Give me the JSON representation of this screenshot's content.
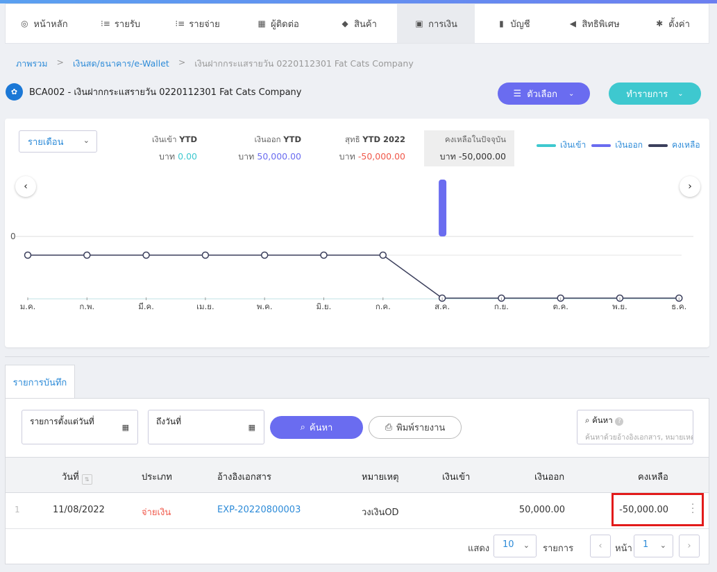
{
  "nav": {
    "items": [
      {
        "label": "หน้าหลัก",
        "icon": "dashboard-icon"
      },
      {
        "label": "รายรับ",
        "icon": "income-icon"
      },
      {
        "label": "รายจ่าย",
        "icon": "expense-icon"
      },
      {
        "label": "ผู้ติดต่อ",
        "icon": "contacts-icon"
      },
      {
        "label": "สินค้า",
        "icon": "product-box-icon"
      },
      {
        "label": "การเงิน",
        "icon": "money-icon"
      },
      {
        "label": "บัญชี",
        "icon": "ledger-icon"
      },
      {
        "label": "สิทธิพิเศษ",
        "icon": "megaphone-icon"
      },
      {
        "label": "ตั้งค่า",
        "icon": "gear-icon"
      }
    ],
    "active": "การเงิน"
  },
  "breadcrumb": {
    "overview": "ภาพรวม",
    "cash_bank": "เงินสด/ธนาคาร/e-Wallet",
    "current": "เงินฝากกระแสรายวัน 0220112301 Fat Cats Company"
  },
  "account": {
    "title": "BCA002 - เงินฝากกระแสรายวัน 0220112301 Fat Cats Company",
    "options_label": "ตัวเลือก",
    "action_label": "ทำรายการ"
  },
  "summary": {
    "period": "รายเดือน",
    "income_label": "เงินเข้า",
    "income_ytd": "YTD",
    "income_value": "0.00",
    "expense_label": "เงินออก",
    "expense_ytd": "YTD",
    "expense_value": "50,000.00",
    "net_label": "สุทธิ",
    "net_ytd": "YTD 2022",
    "net_value": "-50,000.00",
    "balance_label": "คงเหลือในปัจจุบัน",
    "balance_value": "-50,000.00",
    "currency": "บาท"
  },
  "chart_data": {
    "type": "bar",
    "categories": [
      "ม.ค.",
      "ก.พ.",
      "มี.ค.",
      "เม.ย.",
      "พ.ค.",
      "มิ.ย.",
      "ก.ค.",
      "ส.ค.",
      "ก.ย.",
      "ต.ค.",
      "พ.ย.",
      "ธ.ค."
    ],
    "series": [
      {
        "name": "เงินเข้า",
        "type": "bar",
        "color": "#3ec8cf",
        "values": [
          0,
          0,
          0,
          0,
          0,
          0,
          0,
          0,
          0,
          0,
          0,
          0
        ]
      },
      {
        "name": "เงินออก",
        "type": "bar",
        "color": "#6a6cf0",
        "values": [
          0,
          0,
          0,
          0,
          0,
          0,
          0,
          50000,
          0,
          0,
          0,
          0
        ]
      },
      {
        "name": "คงเหลือ",
        "type": "line",
        "color": "#3b3f5c",
        "values": [
          0,
          0,
          0,
          0,
          0,
          0,
          0,
          -50000,
          -50000,
          -50000,
          -50000,
          -50000
        ]
      }
    ],
    "y_tick_label": "0",
    "grid": true
  },
  "tabs": {
    "records": "รายการบันทึก"
  },
  "filters": {
    "from_label": "รายการตั้งแต่วันที่",
    "to_label": "ถึงวันที่",
    "search_button": "ค้นหา",
    "print_button": "พิมพ์รายงาน",
    "search_label": "ค้นหา",
    "search_placeholder": "ค้นหาด้วยอ้างอิงเอกสาร, หมายเหตุ"
  },
  "table": {
    "headers": {
      "date": "วันที่",
      "type": "ประเภท",
      "ref": "อ้างอิงเอกสาร",
      "note": "หมายเหตุ",
      "in": "เงินเข้า",
      "out": "เงินออก",
      "balance": "คงเหลือ"
    },
    "rows": [
      {
        "index": "1",
        "date": "11/08/2022",
        "type": "จ่ายเงิน",
        "ref": "EXP-20220800003",
        "note": "วงเงินOD",
        "in": "",
        "out": "50,000.00",
        "balance": "-50,000.00"
      }
    ]
  },
  "pagination": {
    "show_label": "แสดง",
    "page_size": "10",
    "items_label": "รายการ",
    "page_label": "หน้า",
    "page": "1"
  }
}
